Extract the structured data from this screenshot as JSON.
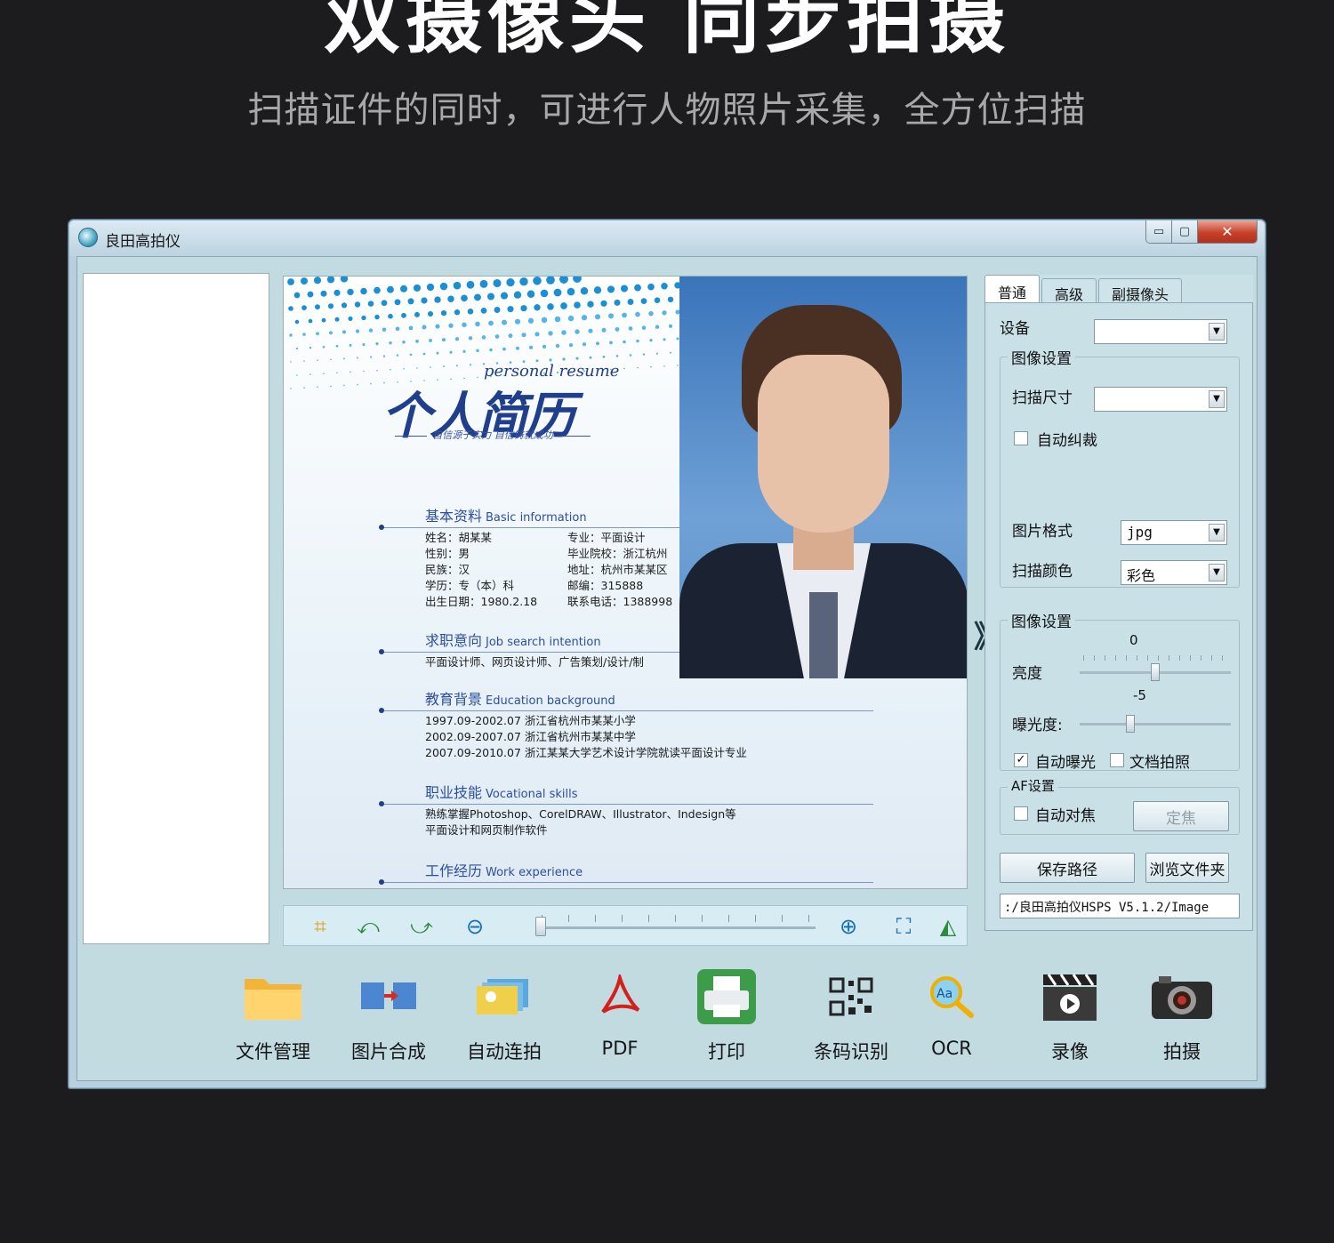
{
  "banner": {
    "headline": "双摄像头 同步拍摄",
    "subline": "扫描证件的同时，可进行人物照片采集，全方位扫描"
  },
  "window": {
    "title": "良田高拍仪",
    "controls": {
      "minimize": "▭",
      "maximize": "▢",
      "close": "✕"
    }
  },
  "resume": {
    "en_title": "personal resume",
    "cn_title": "个人简历",
    "slogan": "自信源于实力 自信铸就成功",
    "basic": {
      "heading_cn": "基本资料",
      "heading_en": "Basic information",
      "rows": [
        [
          "姓名：胡某某",
          "专业：平面设计"
        ],
        [
          "性别：男",
          "毕业院校：浙江杭州"
        ],
        [
          "民族：汉",
          "地址：杭州市某某区"
        ],
        [
          "学历：专（本）科",
          "邮编：315888"
        ],
        [
          "出生日期：1980.2.18",
          "联系电话：1388998"
        ]
      ]
    },
    "job": {
      "heading_cn": "求职意向",
      "heading_en": "Job search intention",
      "text": "平面设计师、网页设计师、广告策划/设计/制"
    },
    "edu": {
      "heading_cn": "教育背景",
      "heading_en": "Education background",
      "lines": [
        "1997.09-2002.07  浙江省杭州市某某小学",
        "2002.09-2007.07  浙江省杭州市某某中学",
        "2007.09-2010.07  浙江某某大学艺术设计学院就读平面设计专业"
      ]
    },
    "skills": {
      "heading_cn": "职业技能",
      "heading_en": "Vocational skills",
      "lines": [
        "熟练掌握Photoshop、CorelDRAW、Illustrator、Indesign等",
        "平面设计和网页制作软件"
      ]
    },
    "work": {
      "heading_cn": "工作经历",
      "heading_en": "Work experience"
    }
  },
  "viewer_toolbar": {
    "icons": [
      "crop-icon",
      "rotate-left-icon",
      "rotate-right-icon",
      "zoom-out-icon",
      "zoom-in-icon",
      "fit-window-icon",
      "mirror-icon"
    ],
    "zoom_level": 0.0
  },
  "arrow_glyph": "》",
  "settings": {
    "tabs": [
      "普通",
      "高级",
      "副摄像头"
    ],
    "active_tab": "普通",
    "device_label": "设备",
    "device_value": "",
    "image_settings_title": "图像设置",
    "scan_size_label": "扫描尺寸",
    "scan_size_value": "",
    "auto_crop_label": "自动纠裁",
    "auto_crop_checked": false,
    "format_label": "图片格式",
    "format_value": "jpg",
    "color_label": "扫描颜色",
    "color_value": "彩色",
    "image_settings2_title": "图像设置",
    "brightness_label": "亮度",
    "brightness_value": "0",
    "exposure_label": "曝光度:",
    "exposure_value": "-5",
    "auto_exposure_label": "自动曝光",
    "auto_exposure_checked": true,
    "doc_photo_label": "文档拍照",
    "doc_photo_checked": false,
    "af_title": "AF设置",
    "auto_focus_label": "自动对焦",
    "auto_focus_checked": false,
    "focus_button": "定焦",
    "save_path_button": "保存路径",
    "browse_button": "浏览文件夹",
    "path_value": ":/良田高拍仪HSPS V5.1.2/Image"
  },
  "tools": [
    {
      "label": "文件管理",
      "icon": "folder-icon"
    },
    {
      "label": "图片合成",
      "icon": "image-merge-icon"
    },
    {
      "label": "自动连拍",
      "icon": "auto-burst-icon"
    },
    {
      "label": "PDF",
      "icon": "pdf-icon"
    },
    {
      "label": "打印",
      "icon": "printer-icon"
    },
    {
      "label": "条码识别",
      "icon": "barcode-icon"
    },
    {
      "label": "OCR",
      "icon": "ocr-icon"
    },
    {
      "label": "录像",
      "icon": "video-icon"
    },
    {
      "label": "拍摄",
      "icon": "camera-icon"
    }
  ],
  "colors": {
    "page_bg": "#1c1c1e",
    "window_bg": "#c1dbe1",
    "resume_blue": "#1f3e8c",
    "close_red": "#c7402a"
  }
}
